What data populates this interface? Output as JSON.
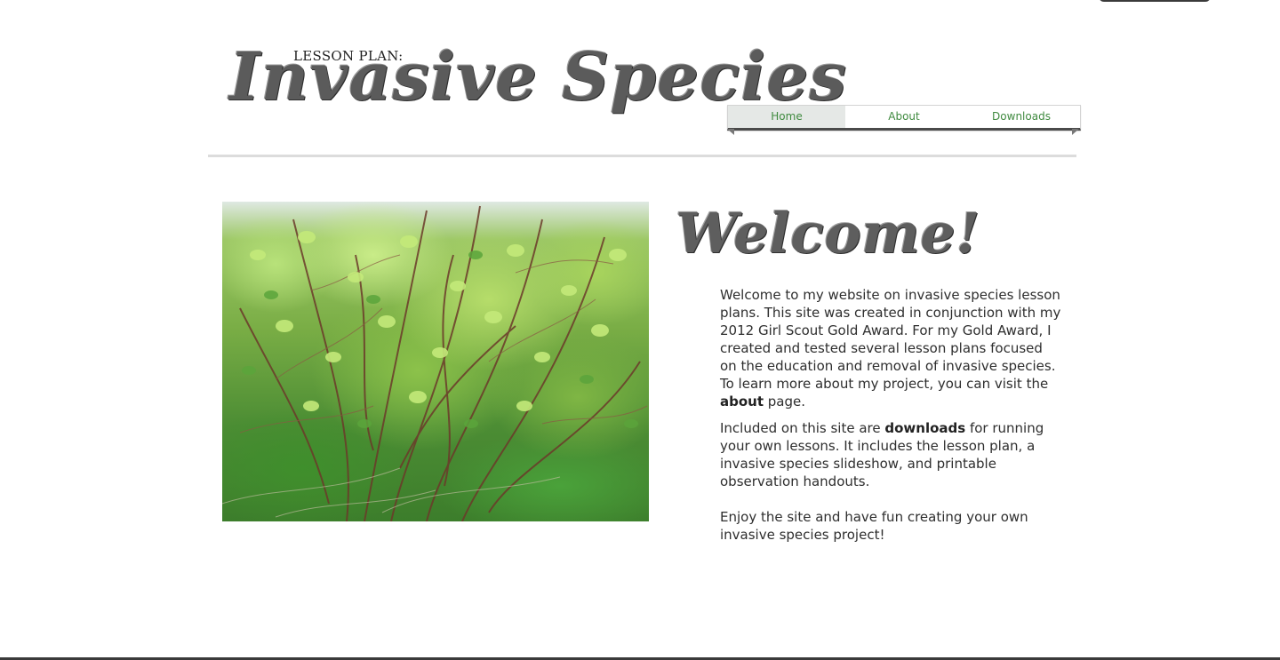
{
  "header": {
    "lesson_label": "LESSON PLAN:",
    "title": "Invasive Species"
  },
  "nav": {
    "items": [
      {
        "label": "Home",
        "active": true
      },
      {
        "label": "About",
        "active": false
      },
      {
        "label": "Downloads",
        "active": false
      }
    ],
    "link_color": "#3f8a3f",
    "active_bg": "#e5e8e6"
  },
  "hero_image": {
    "subject": "invasive-shrub-photo"
  },
  "main": {
    "heading": "Welcome!",
    "p1_text_1": "Welcome to my website on invasive species lesson plans. This site was created in conjunction with my 2012 Girl Scout Gold Award. For my Gold Award, I created and tested several lesson plans focused on the education and removal of invasive species. To learn more about my project, you can visit the ",
    "p1_link": "about",
    "p1_text_2": " page.",
    "p2_text_1": "Included on this site are ",
    "p2_link": "downloads",
    "p2_text_2": " for running your own lessons. It includes the lesson plan, a invasive species slideshow, and printable observation handouts.",
    "p3_text": "Enjoy the site and have fun creating your own invasive species project!"
  }
}
